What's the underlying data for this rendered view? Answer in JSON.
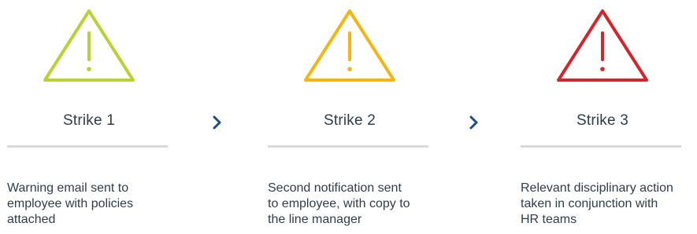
{
  "strikes": [
    {
      "label": "Strike 1",
      "color": "#b8d233",
      "icon": "warning-triangle-icon",
      "description": [
        "Warning email sent to",
        "employee with policies",
        "attached"
      ]
    },
    {
      "label": "Strike 2",
      "color": "#f3b511",
      "icon": "warning-triangle-icon",
      "description": [
        "Second notification sent",
        "to employee, with copy to",
        "the line manager"
      ]
    },
    {
      "label": "Strike 3",
      "color": "#d1262b",
      "icon": "warning-triangle-icon",
      "description": [
        "Relevant disciplinary action",
        "taken in conjunction with",
        "HR teams"
      ]
    }
  ],
  "connector": {
    "icon": "chevron-right-icon",
    "color": "#1b4f8c"
  },
  "divider_color": "#d9d9d9"
}
